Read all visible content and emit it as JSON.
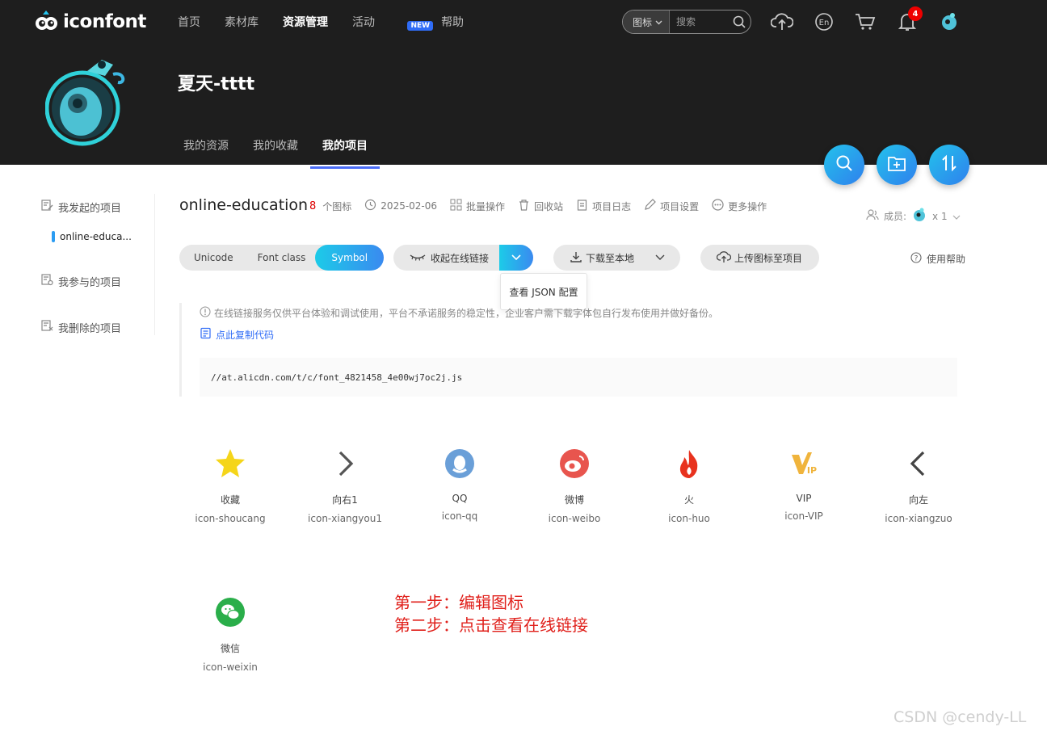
{
  "header": {
    "logo_text": "iconfont",
    "nav": [
      {
        "label": "首页"
      },
      {
        "label": "素材库"
      },
      {
        "label": "资源管理",
        "active": true
      },
      {
        "label": "活动",
        "badge": "NEW"
      },
      {
        "label": "帮助"
      }
    ],
    "search": {
      "type": "图标",
      "placeholder": "搜索"
    },
    "notification_count": "4"
  },
  "profile": {
    "name": "夏天-tttt",
    "tabs": [
      {
        "label": "我的资源"
      },
      {
        "label": "我的收藏"
      },
      {
        "label": "我的项目",
        "active": true
      }
    ]
  },
  "sidebar": {
    "started": "我发起的项目",
    "current_project": "online-educa...",
    "joined": "我参与的项目",
    "deleted": "我删除的项目"
  },
  "project": {
    "title": "online-education",
    "icon_count": "8",
    "icon_count_label": "个图标",
    "date": "2025-02-06",
    "actions": [
      "批量操作",
      "回收站",
      "项目日志",
      "项目设置",
      "更多操作"
    ],
    "members_label": "成员:",
    "members_count": "x 1"
  },
  "toolbar": {
    "formats": [
      "Unicode",
      "Font class",
      "Symbol"
    ],
    "online_link": "收起在线链接",
    "dropdown_item": "查看 JSON 配置",
    "download": "下载至本地",
    "upload": "上传图标至项目",
    "help": "使用帮助"
  },
  "notice": {
    "warning": "在线链接服务仅供平台体验和调试使用，平台不承诺服务的稳定性，企业客户需下载字体包自行发布使用并做好备份。",
    "copy": "点此复制代码",
    "code": "//at.alicdn.com/t/c/font_4821458_4e00wj7oc2j.js"
  },
  "icons": [
    {
      "name": "收藏",
      "code": "icon-shoucang",
      "color": "#f5c518"
    },
    {
      "name": "向右1",
      "code": "icon-xiangyou1",
      "color": "#555555"
    },
    {
      "name": "QQ",
      "code": "icon-qq",
      "color": "#5b9bd5"
    },
    {
      "name": "微博",
      "code": "icon-weibo",
      "color": "#e8554e"
    },
    {
      "name": "火",
      "code": "icon-huo",
      "color": "#e8321e"
    },
    {
      "name": "VIP",
      "code": "icon-VIP",
      "color": "#f0b43c"
    },
    {
      "name": "向左",
      "code": "icon-xiangzuo",
      "color": "#444444"
    },
    {
      "name": "微信",
      "code": "icon-weixin",
      "color": "#2aae4a"
    }
  ],
  "annotation": {
    "step1": "第一步：编辑图标",
    "step2": "第二步：点击查看在线链接"
  },
  "watermark": "CSDN @cendy-LL"
}
